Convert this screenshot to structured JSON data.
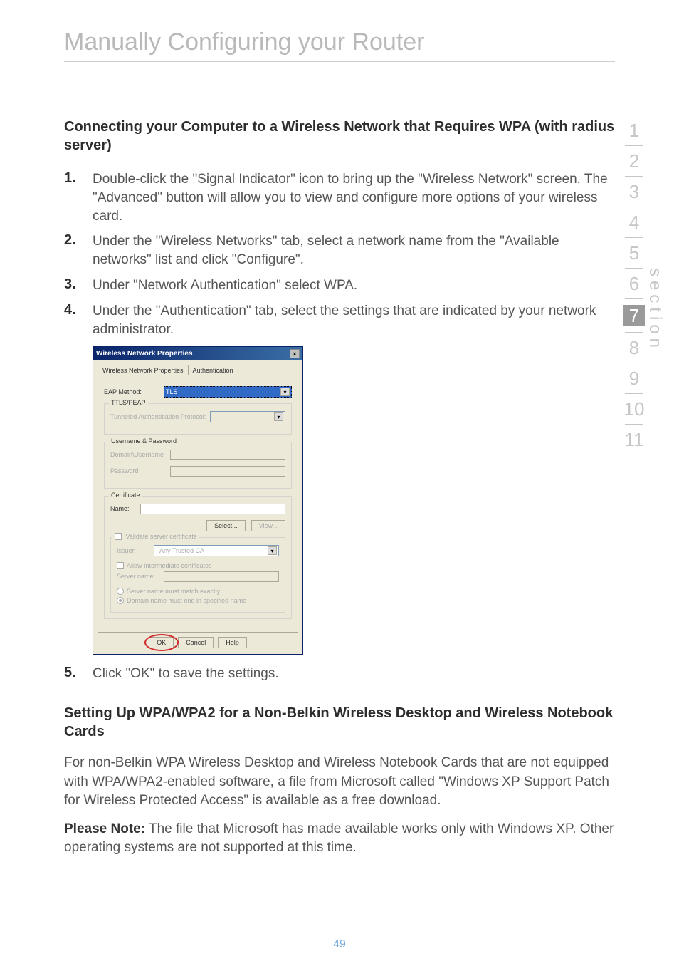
{
  "chapterTitle": "Manually Configuring your Router",
  "heading1": "Connecting your Computer to a Wireless Network that Requires WPA (with radius server)",
  "steps1": [
    {
      "num": "1.",
      "text": "Double-click the \"Signal Indicator\" icon to bring up the \"Wireless Network\" screen. The \"Advanced\" button will allow you to view and configure more options of your wireless card."
    },
    {
      "num": "2.",
      "text": "Under the \"Wireless Networks\" tab, select a network name from the \"Available networks\" list and click \"Configure\"."
    },
    {
      "num": "3.",
      "text": "Under \"Network Authentication\" select WPA."
    },
    {
      "num": "4.",
      "text": "Under the \"Authentication\" tab, select the settings that are indicated by your network administrator."
    }
  ],
  "step5": {
    "num": "5.",
    "text": "Click \"OK\" to save the settings."
  },
  "heading2": "Setting Up WPA/WPA2 for a Non-Belkin Wireless Desktop and Wireless Notebook Cards",
  "para1": "For non-Belkin WPA Wireless Desktop and Wireless Notebook Cards that are not equipped with WPA/WPA2-enabled software, a file from Microsoft called \"Windows XP Support Patch for Wireless Protected Access\" is available as a free download.",
  "noteLabel": "Please Note:",
  "noteText": " The file that Microsoft has made available works only with Windows XP. Other operating systems are not supported at this time.",
  "pageNumber": "49",
  "sideLabel": "section",
  "nav": [
    "1",
    "2",
    "3",
    "4",
    "5",
    "6",
    "7",
    "8",
    "9",
    "10",
    "11"
  ],
  "navActive": "7",
  "dialog": {
    "title": "Wireless Network Properties",
    "closeGlyph": "×",
    "tab1": "Wireless Network Properties",
    "tab2": "Authentication",
    "eapMethodLabel": "EAP Method:",
    "eapMethodValue": "TLS",
    "grpTtls": "TTLS/PEAP",
    "tunneledLabel": "Tunneled Authentication Protocol:",
    "grpUserPw": "Username & Password",
    "domainUserLabel": "Domain\\Username",
    "passwordLabel": "Password",
    "grpCert": "Certificate",
    "nameLabel": "Name:",
    "selectBtn": "Select...",
    "viewBtn": "View...",
    "validateLabel": "Validate server certificate",
    "issuerLabel": "Issuer:",
    "issuerValue": "- Any Trusted CA -",
    "allowIntermediate": "Allow Intermediate certificates",
    "serverNameLabel": "Server name:",
    "radioExact": "Server name must match exactly",
    "radioEnd": "Domain name must end in specified name",
    "okBtn": "OK",
    "cancelBtn": "Cancel",
    "helpBtn": "Help"
  }
}
